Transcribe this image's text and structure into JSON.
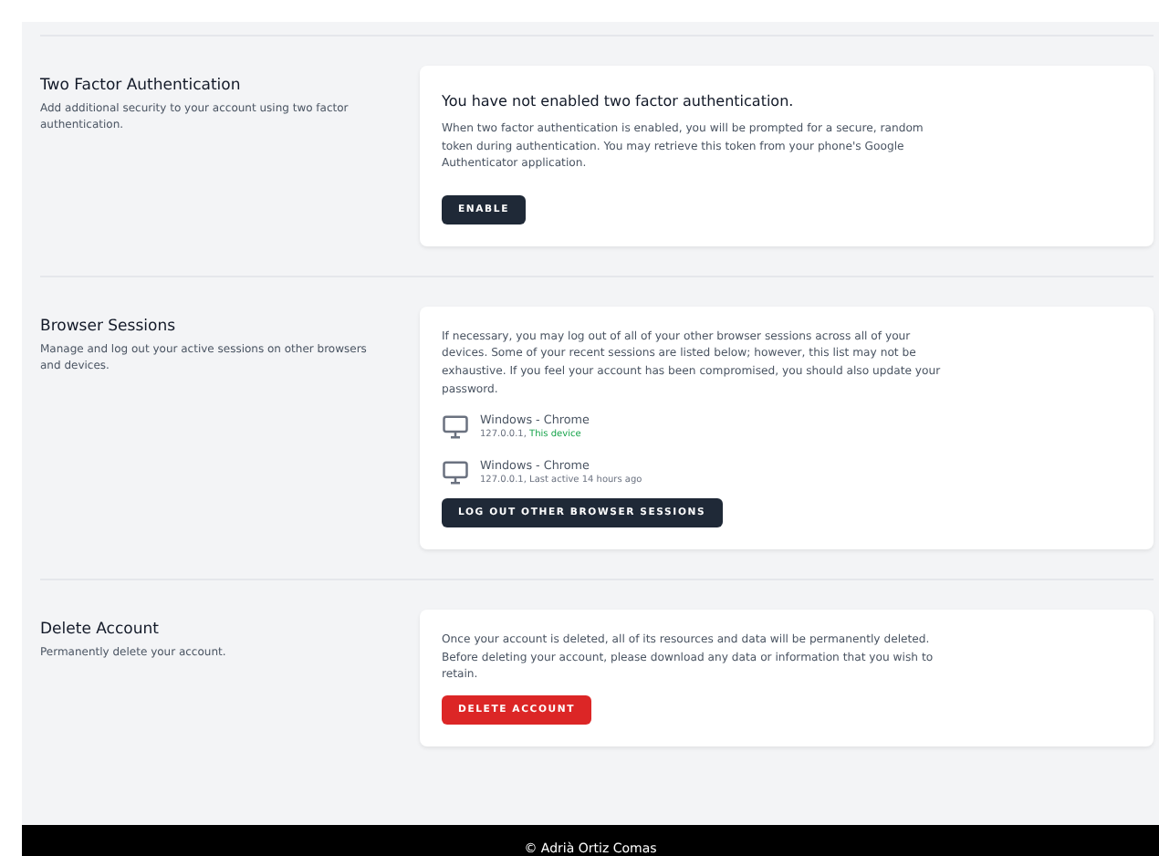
{
  "sections": [
    {
      "kind": "two_factor",
      "title": "Two Factor Authentication",
      "description": "Add additional security to your account using two factor authentication.",
      "heading": "You have not enabled two factor authentication.",
      "body": "When two factor authentication is enabled, you will be prompted for a secure, random token during authentication. You may retrieve this token from your phone's Google Authenticator application.",
      "button": "ENABLE"
    },
    {
      "kind": "sessions",
      "title": "Browser Sessions",
      "description": "Manage and log out your active sessions on other browsers and devices.",
      "body": "If necessary, you may log out of all of your other browser sessions across all of your devices. Some of your recent sessions are listed below; however, this list may not be exhaustive. If you feel your account has been compromised, you should also update your password.",
      "sessions": [
        {
          "name": "Windows - Chrome",
          "ip": "127.0.0.1,",
          "status": "This device",
          "current": true
        },
        {
          "name": "Windows - Chrome",
          "ip": "127.0.0.1,",
          "status": "Last active 14 hours ago",
          "current": false
        }
      ],
      "button": "LOG OUT OTHER BROWSER SESSIONS"
    },
    {
      "kind": "delete",
      "title": "Delete Account",
      "description": "Permanently delete your account.",
      "body": "Once your account is deleted, all of its resources and data will be permanently deleted. Before deleting your account, please download any data or information that you wish to retain.",
      "button": "DELETE ACCOUNT"
    }
  ],
  "footer": "© Adrià Ortiz Comas"
}
